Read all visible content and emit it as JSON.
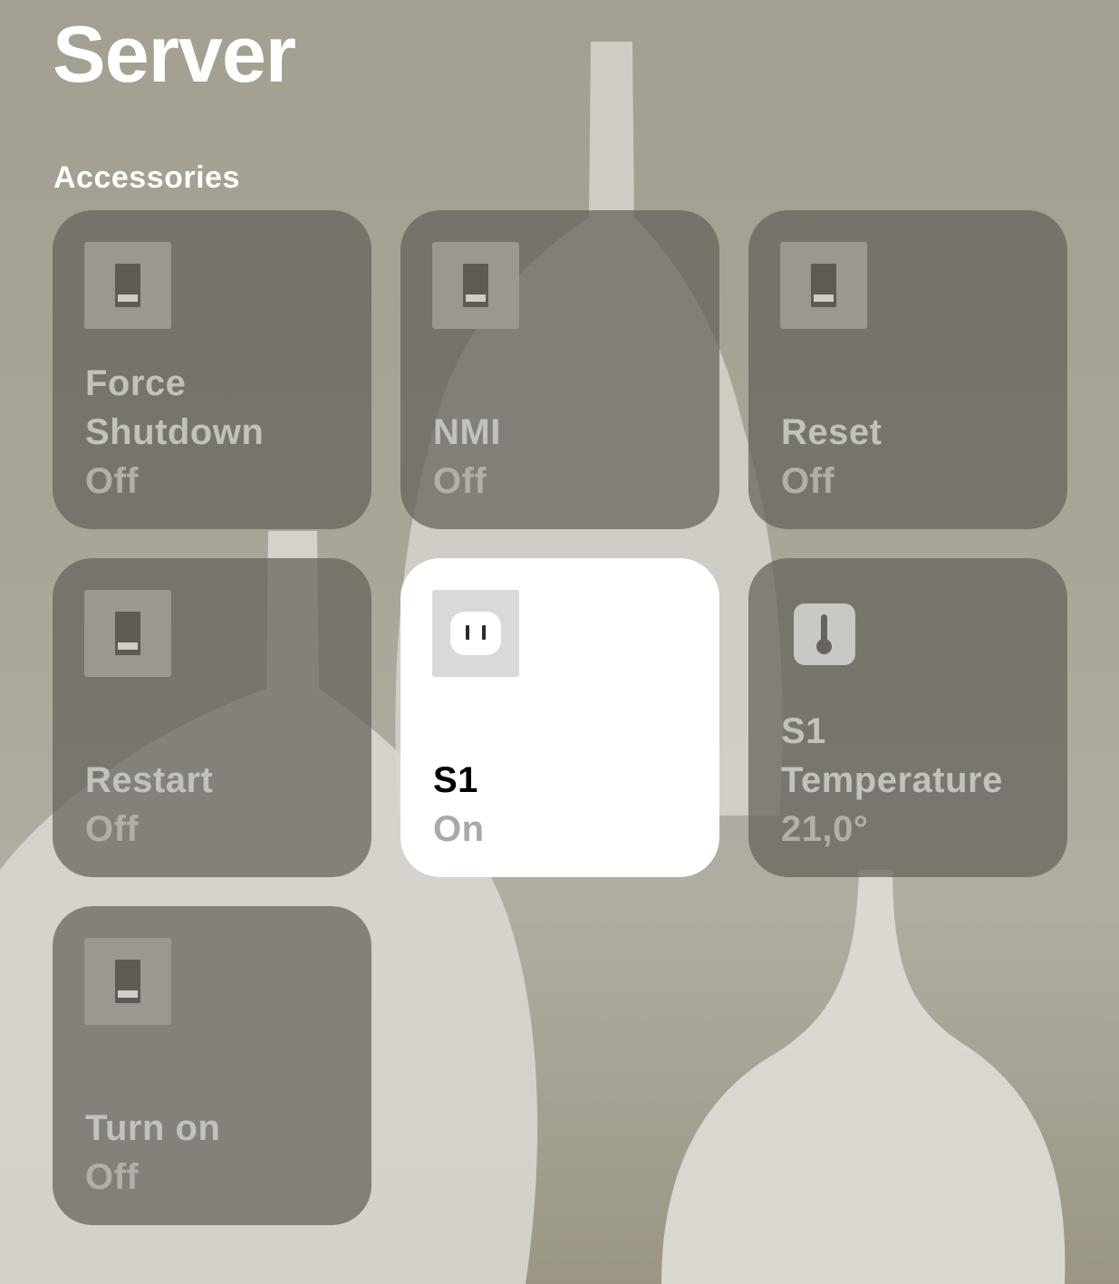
{
  "header": {
    "title": "Server",
    "section_title": "Accessories"
  },
  "tiles": [
    {
      "name": "Force Shutdown",
      "state": "Off",
      "icon": "switch-icon",
      "on": false
    },
    {
      "name": "NMI",
      "state": "Off",
      "icon": "switch-icon",
      "on": false
    },
    {
      "name": "Reset",
      "state": "Off",
      "icon": "switch-icon",
      "on": false
    },
    {
      "name": "Restart",
      "state": "Off",
      "icon": "switch-icon",
      "on": false
    },
    {
      "name": "S1",
      "state": "On",
      "icon": "outlet-icon",
      "on": true
    },
    {
      "name": "S1 Temperature",
      "state": "21,0°",
      "icon": "thermometer-icon",
      "on": false
    },
    {
      "name": "Turn on",
      "state": "Off",
      "icon": "switch-icon",
      "on": false
    }
  ],
  "colors": {
    "tile_off": "#64615a",
    "tile_on": "#ffffff",
    "text_on": "#000000",
    "text_off": "#c3c1bb"
  }
}
